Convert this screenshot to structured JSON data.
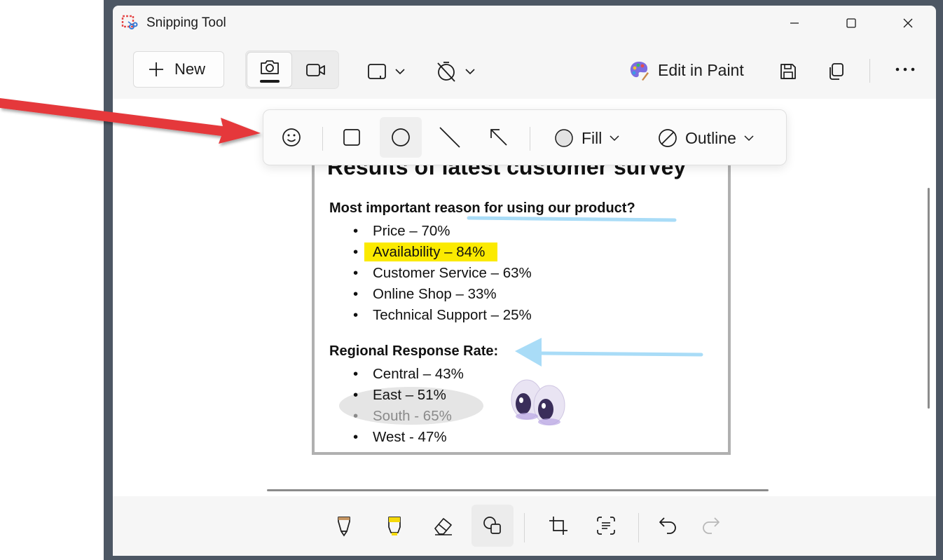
{
  "window": {
    "title": "Snipping Tool"
  },
  "toolbar": {
    "new_label": "New",
    "edit_in_paint_label": "Edit in Paint"
  },
  "annotation_bar": {
    "fill_label": "Fill",
    "outline_label": "Outline"
  },
  "document": {
    "title": "Results of latest customer survey",
    "question1": "Most important reason for using our product?",
    "reasons": [
      "Price – 70%",
      "Availability – 84%",
      "Customer Service – 63%",
      "Online Shop – 33%",
      "Technical Support – 25%"
    ],
    "question2": "Regional Response Rate:",
    "regions": [
      "Central – 43%",
      "East – 51%",
      "South - 65%",
      "West - 47%"
    ]
  },
  "colors": {
    "highlight": "#fbea00",
    "pen_blue": "#a9dcf7",
    "red_arrow": "#e5373a"
  },
  "icons": [
    "plus-icon",
    "camera-icon",
    "video-icon",
    "rectangle-mode-icon",
    "timer-off-icon",
    "paint-palette-icon",
    "save-icon",
    "copy-icon",
    "more-icon",
    "emoji-icon",
    "rectangle-shape-icon",
    "ellipse-shape-icon",
    "line-shape-icon",
    "arrow-shape-icon",
    "pen-icon",
    "highlighter-icon",
    "eraser-icon",
    "shapes-icon",
    "crop-icon",
    "text-actions-icon",
    "undo-icon",
    "redo-icon",
    "eyes-emoji-sticker"
  ]
}
